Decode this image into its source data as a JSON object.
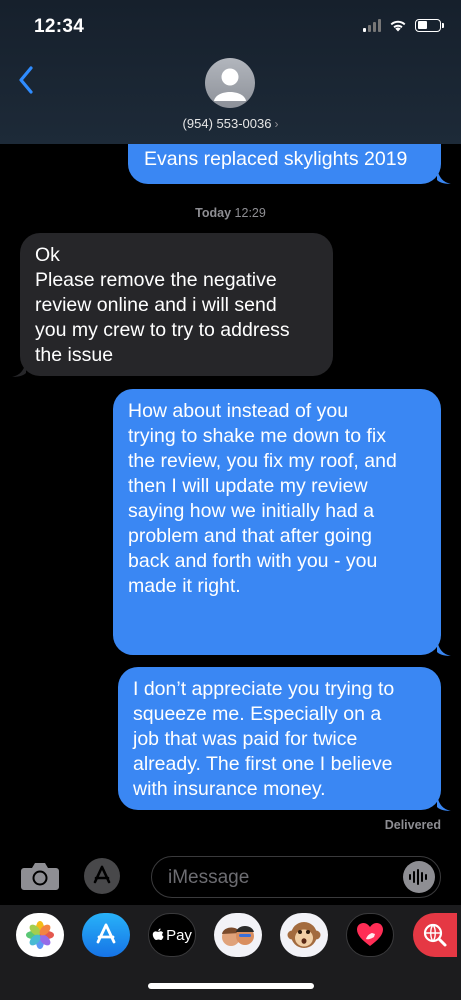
{
  "status_bar": {
    "time": "12:34"
  },
  "header": {
    "contact": "(954) 553-0036",
    "chevron": "›"
  },
  "messages": {
    "m1": {
      "text": "Evans replaced skylights 2019"
    },
    "timestamp_day": "Today",
    "timestamp_time": "12:29",
    "m2": {
      "text": "Ok\nPlease remove the negative\nreview online and i will send\nyou my crew to try to address\nthe issue"
    },
    "m3": {
      "text": "How about  instead of you\ntrying to shake me down to fix\nthe review,  you fix my roof, and\nthen I will update my review\nsaying how we initially had a\nproblem and that after going\nback and forth with you - you\nmade it right."
    },
    "m4": {
      "text": "I don’t appreciate you trying to\nsqueeze me. Especially on a\njob that was paid for twice\nalready. The first one I believe\nwith insurance money."
    },
    "delivered": "Delivered"
  },
  "input_bar": {
    "placeholder": "iMessage"
  },
  "app_drawer": {
    "apps": [
      {
        "icon": "photos-icon"
      },
      {
        "icon": "appstore-icon"
      },
      {
        "label": "Pay",
        "icon": "apple-pay-icon"
      },
      {
        "icon": "memoji-icon"
      },
      {
        "icon": "monkey-animoji-icon"
      },
      {
        "icon": "digital-touch-icon"
      },
      {
        "icon": "web-search-icon"
      }
    ]
  },
  "colors": {
    "outgoing_bubble": "#3a87f3",
    "incoming_bubble": "#262629",
    "header_bg": "#1a2532",
    "accent_blue": "#2f8cff"
  }
}
